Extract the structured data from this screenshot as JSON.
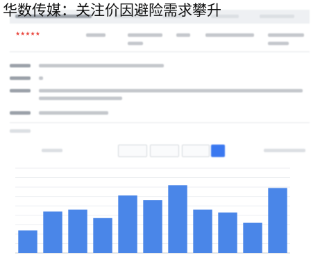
{
  "page": {
    "headline": "华数传媒：关注价因避险需求攀升"
  },
  "table": {
    "rating_stars": "★★★★★"
  },
  "colors": {
    "bar": "#4a86e8",
    "accent": "#3a78f0",
    "rating": "#e8453c"
  },
  "chart_data": {
    "type": "bar",
    "title": "",
    "xlabel": "",
    "ylabel": "",
    "categories": [
      "",
      "",
      "",
      "",
      "",
      "",
      "",
      "",
      "",
      "",
      ""
    ],
    "values": [
      2.4,
      4.4,
      4.6,
      3.7,
      6.1,
      5.6,
      7.2,
      4.6,
      4.3,
      3.2,
      6.9
    ],
    "ylim": [
      0,
      9
    ],
    "yticks": [
      0,
      1,
      2,
      3,
      4,
      5,
      6,
      7,
      8,
      9
    ],
    "grid": true,
    "legend": "none"
  }
}
